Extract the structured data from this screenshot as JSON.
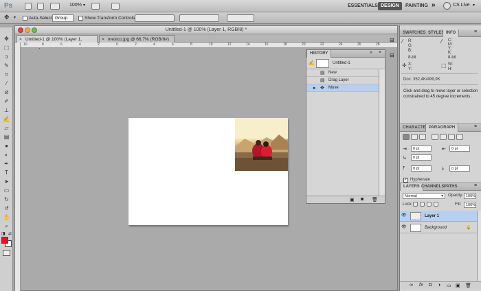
{
  "appbar": {
    "logo": "Ps",
    "zoom": "100%",
    "workspaces": [
      "ESSENTIALS",
      "DESIGN",
      "PAINTING"
    ],
    "more": "»",
    "cslive": "CS Live"
  },
  "options": {
    "auto_select_label": "Auto-Select:",
    "auto_select_value": "Group",
    "transform_label": "Show Transform Controls"
  },
  "doc": {
    "title": "Untitled-1 @ 100% (Layer 1, RGB/8) *",
    "tabs": [
      "Untitled-1 @ 100% (Layer 1, RGB/8) *",
      "mexico.jpg @ 66,7% (RGB/8#)"
    ],
    "ruler_labels": [
      "10",
      "8",
      "6",
      "4",
      "2",
      "0",
      "2",
      "4",
      "6",
      "8",
      "10",
      "12",
      "14",
      "16",
      "18",
      "20",
      "22",
      "24",
      "26",
      "28"
    ]
  },
  "history": {
    "tab": "HISTORY",
    "snapshot": "Untitled-1",
    "items": [
      "New",
      "Drag Layer",
      "Move"
    ]
  },
  "info": {
    "tabs": [
      "SWATCHES",
      "STYLES",
      "INFO"
    ],
    "rgb": [
      "R:",
      "G:",
      "B:"
    ],
    "cmyk": [
      "C:",
      "M:",
      "Y:",
      "K:"
    ],
    "bit_left": "8-bit",
    "bit_right": "8-bit",
    "xy": [
      "X:",
      "Y:"
    ],
    "wh": [
      "W:",
      "H:"
    ],
    "doc_size": "Doc: 352,4K/499,9K",
    "hint": "Click and drag to move layer or selection constrained to 45 degree increments."
  },
  "paragraph": {
    "tabs": [
      "CHARACTER",
      "PARAGRAPH"
    ],
    "fields": [
      "0 pt",
      "0 pt",
      "0 pt",
      "0 pt",
      "0 pt"
    ],
    "hyphenate": "Hyphenate"
  },
  "layers": {
    "tabs": [
      "LAYERS",
      "CHANNELS",
      "PATHS"
    ],
    "blend": "Normal",
    "opacity_label": "Opacity:",
    "opacity": "100%",
    "lock_label": "Lock:",
    "fill_label": "Fill:",
    "fill": "100%",
    "items": [
      "Layer 1",
      "Background"
    ]
  },
  "colors": {
    "accent": "#b7d0f0",
    "foreground": "#e8141b"
  }
}
